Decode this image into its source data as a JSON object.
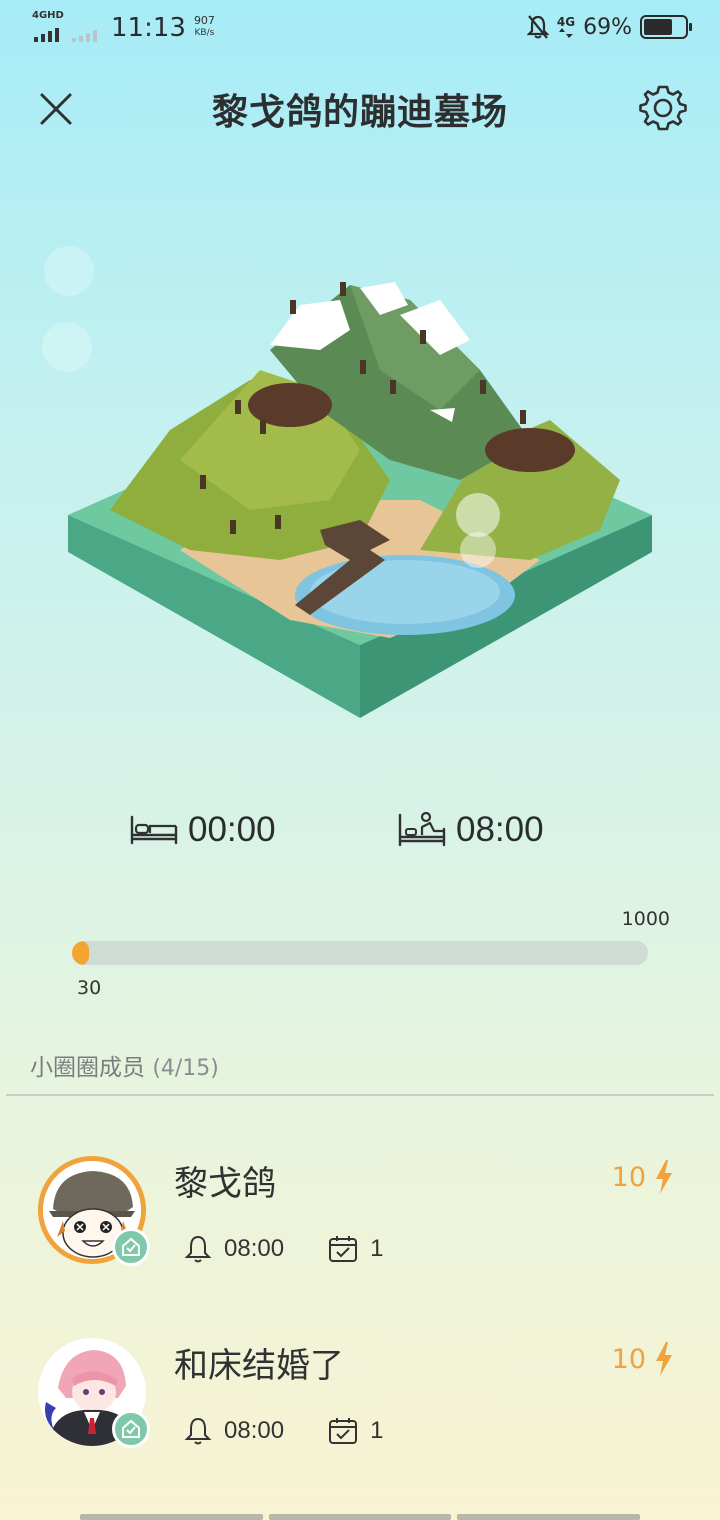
{
  "status_bar": {
    "network_label": "4GHD",
    "time": "11:13",
    "speed_value": "907",
    "speed_unit": "KB/s",
    "cell_label": "4G",
    "battery_percent": "69%",
    "battery_level": 0.69
  },
  "header": {
    "title": "黎戈鸽的蹦迪墓场",
    "close_icon": "close-icon",
    "settings_icon": "gear-icon"
  },
  "schedule": {
    "sleep_time": "00:00",
    "wake_time": "08:00",
    "sleep_icon": "bed-icon",
    "wake_icon": "wake-bed-icon"
  },
  "progress": {
    "max_label": "1000",
    "current_label": "30",
    "fraction": 0.03,
    "color": "#f4a431"
  },
  "members": {
    "label": "小圈圈成员",
    "count": "(4/15)",
    "items": [
      {
        "name": "黎戈鸽",
        "energy": "10",
        "alarm": "08:00",
        "days": "1"
      },
      {
        "name": "和床结婚了",
        "energy": "10",
        "alarm": "08:00",
        "days": "1"
      }
    ]
  },
  "colors": {
    "accent": "#f0a23b",
    "verified": "#7fc8a9"
  }
}
